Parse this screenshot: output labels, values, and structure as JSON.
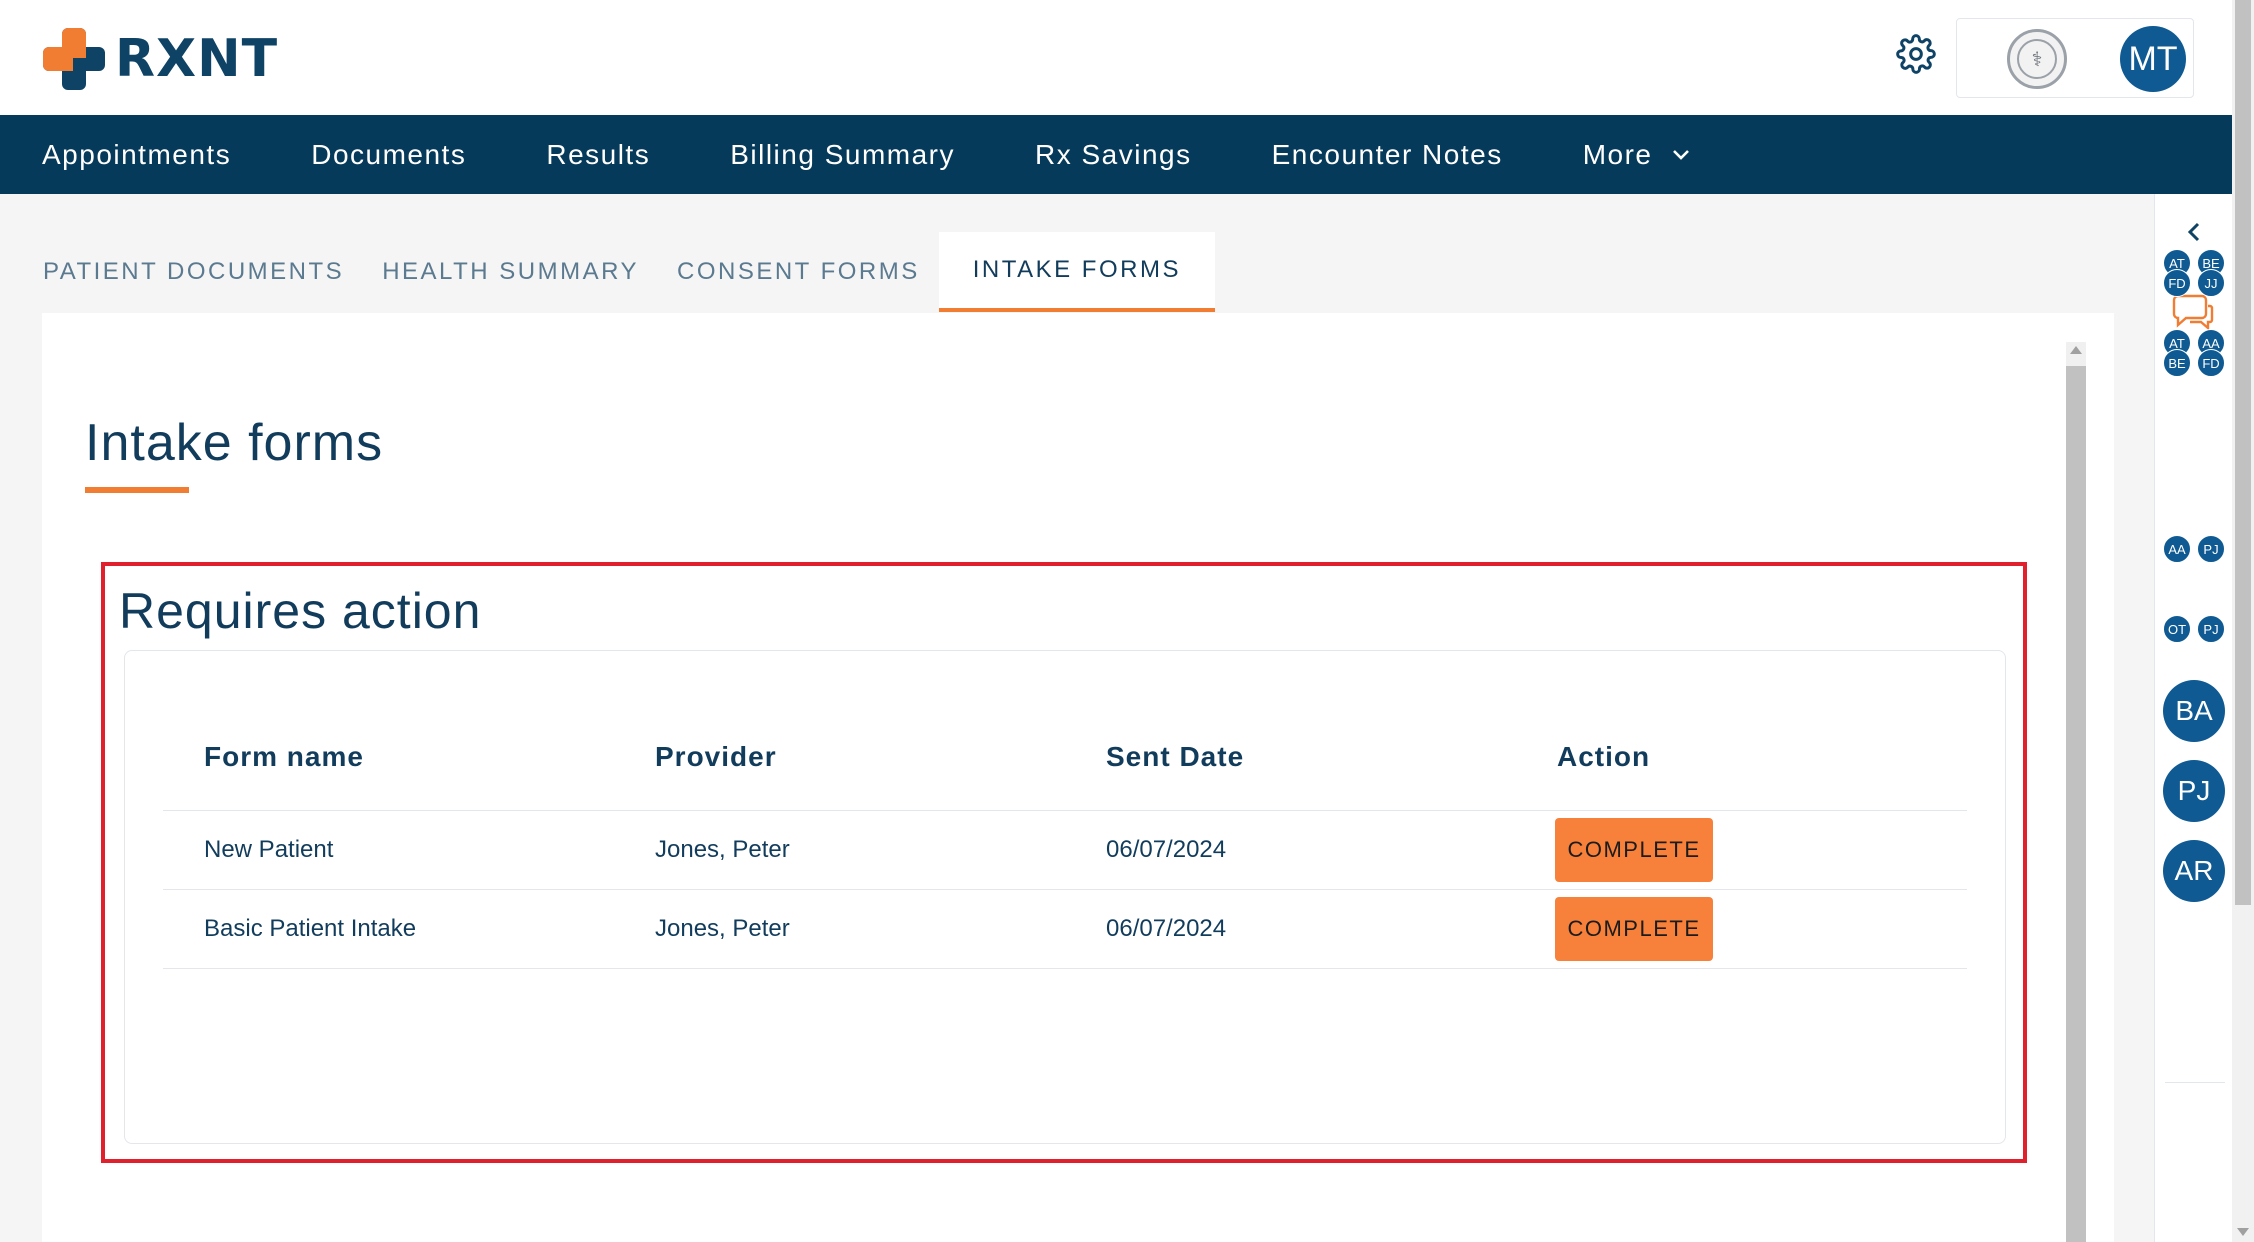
{
  "brand": {
    "name": "RXNT"
  },
  "header": {
    "user_initials": "MT"
  },
  "nav": {
    "items": [
      "Appointments",
      "Documents",
      "Results",
      "Billing Summary",
      "Rx Savings",
      "Encounter Notes"
    ],
    "more_label": "More"
  },
  "tabs": [
    {
      "label": "PATIENT DOCUMENTS",
      "active": false
    },
    {
      "label": "HEALTH SUMMARY",
      "active": false
    },
    {
      "label": "CONSENT FORMS",
      "active": false
    },
    {
      "label": "INTAKE FORMS",
      "active": true
    }
  ],
  "page": {
    "title": "Intake forms"
  },
  "requires_action": {
    "title": "Requires action",
    "columns": [
      "Form name",
      "Provider",
      "Sent Date",
      "Action"
    ],
    "rows": [
      {
        "form_name": "New Patient",
        "provider": "Jones, Peter",
        "sent_date": "06/07/2024",
        "action": "COMPLETE"
      },
      {
        "form_name": "Basic Patient Intake",
        "provider": "Jones, Peter",
        "sent_date": "06/07/2024",
        "action": "COMPLETE"
      }
    ]
  },
  "sidebar": {
    "groups": [
      [
        "AT",
        "BE",
        "FD",
        "JJ"
      ],
      [
        "AT",
        "AA",
        "BE",
        "FD"
      ],
      [
        "AA",
        "PJ"
      ],
      [
        "OT",
        "PJ"
      ]
    ],
    "avatars": [
      "BA",
      "PJ",
      "AR"
    ]
  },
  "colors": {
    "nav_bg": "#063a5a",
    "accent": "#f07d32",
    "highlight_border": "#e0202c",
    "avatar": "#0f5a92"
  },
  "icons": [
    "gear-icon",
    "chevron-down-icon",
    "chevron-left-icon",
    "chat-icon",
    "medical-seal-icon"
  ]
}
